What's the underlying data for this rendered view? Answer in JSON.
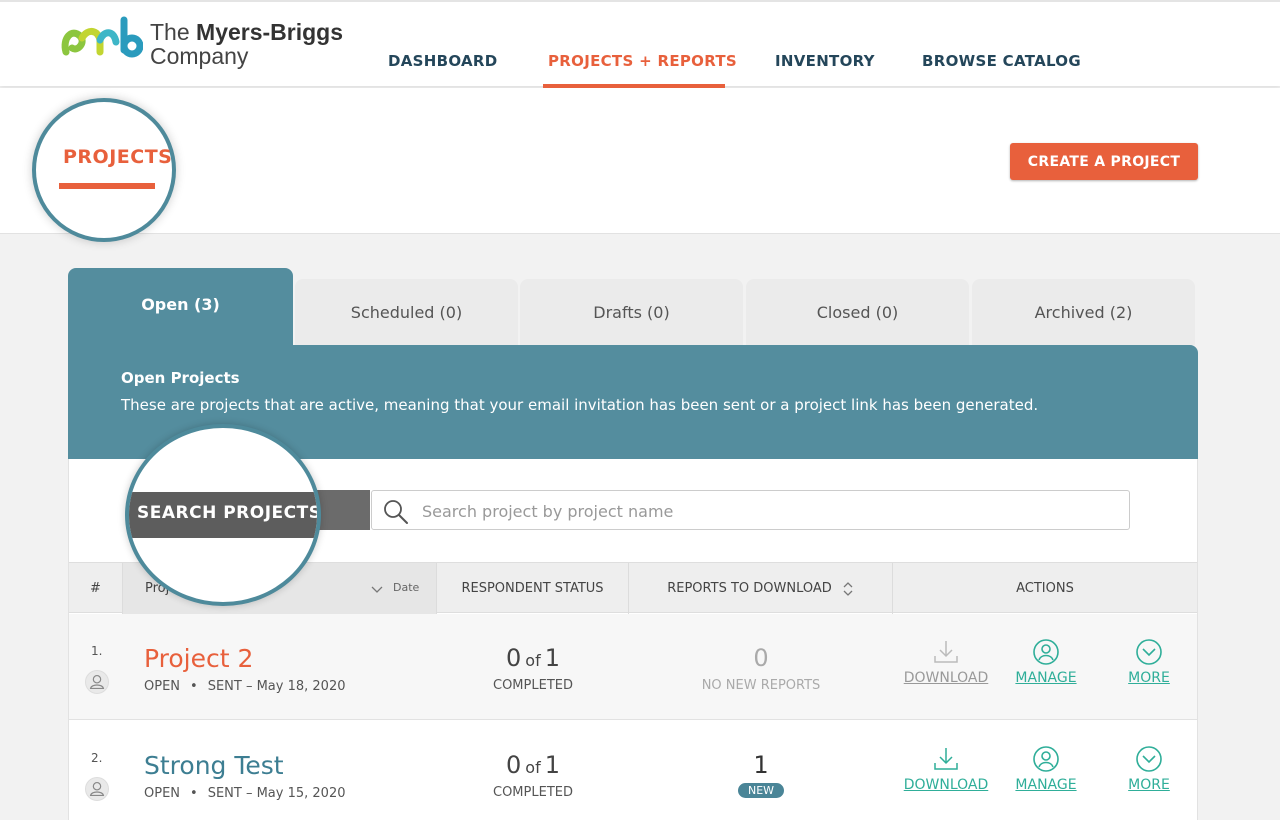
{
  "brand": {
    "name_line1_prefix": "The ",
    "name_line1_bold": "Myers-Briggs",
    "name_line2": "Company"
  },
  "nav": {
    "items": [
      "DASHBOARD",
      "PROJECTS + REPORTS",
      "INVENTORY",
      "BROWSE CATALOG"
    ],
    "active": "PROJECTS + REPORTS"
  },
  "page": {
    "title": "PROJECTS",
    "create_button": "CREATE A PROJECT"
  },
  "tabs": [
    {
      "label": "Open (3)",
      "active": true
    },
    {
      "label": "Scheduled (0)",
      "active": false
    },
    {
      "label": "Drafts (0)",
      "active": false
    },
    {
      "label": "Closed (0)",
      "active": false
    },
    {
      "label": "Archived (2)",
      "active": false
    }
  ],
  "info": {
    "title": "Open Projects",
    "description": "These are projects that are active, meaning that your email invitation has been sent or a project link has been generated."
  },
  "search": {
    "label": "SEARCH PROJECTS",
    "placeholder": "Search project by project name",
    "value": ""
  },
  "table": {
    "headers": {
      "num": "#",
      "project": "Proj",
      "date": "Date",
      "status": "RESPONDENT STATUS",
      "reports": "REPORTS TO DOWNLOAD",
      "actions": "ACTIONS"
    },
    "rows": [
      {
        "num": "1.",
        "name": "Project 2",
        "state": "OPEN",
        "sent": "SENT – May 18, 2020",
        "completed": "0",
        "of": "of",
        "total": "1",
        "status_label": "COMPLETED",
        "reports_count": "0",
        "reports_label": "NO NEW REPORTS",
        "download": "DOWNLOAD",
        "manage": "MANAGE",
        "more": "MORE"
      },
      {
        "num": "2.",
        "name": "Strong Test",
        "state": "OPEN",
        "sent": "SENT – May 15, 2020",
        "completed": "0",
        "of": "of",
        "total": "1",
        "status_label": "COMPLETED",
        "reports_count": "1",
        "reports_badge": "NEW",
        "download": "DOWNLOAD",
        "manage": "MANAGE",
        "more": "MORE"
      }
    ]
  },
  "colors": {
    "accent": "#e8603c",
    "teal": "#548d9e",
    "navy": "#24465a",
    "green": "#2fae99"
  }
}
